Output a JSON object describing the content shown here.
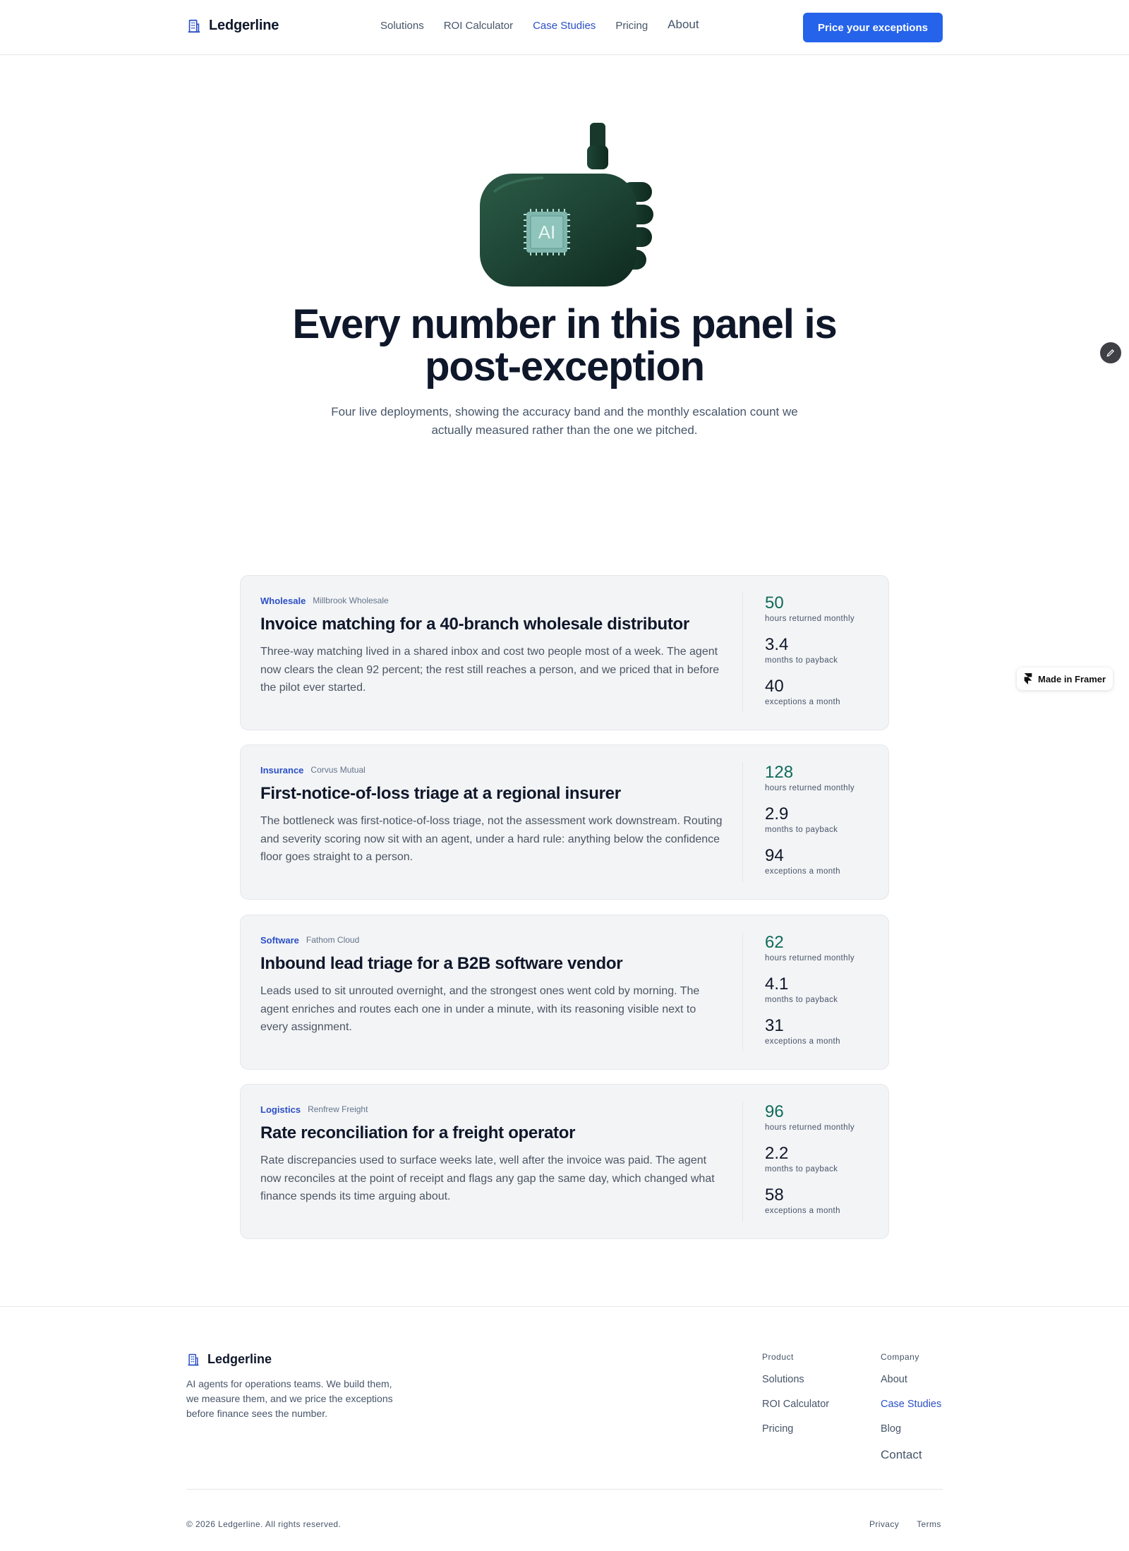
{
  "brand": {
    "name": "Ledgerline"
  },
  "nav": {
    "links": [
      "Solutions",
      "ROI Calculator",
      "Case Studies",
      "Pricing",
      "About"
    ],
    "active_link": "Case Studies",
    "cta_label": "Price your exceptions"
  },
  "hero": {
    "chip_label": "AI",
    "title": "Every number in this panel is post-exception",
    "subtitle": "Four live deployments, showing the accuracy band and the monthly escalation count we actually measured rather than the one we pitched."
  },
  "badges": {
    "framer": "Made in Framer"
  },
  "cases": [
    {
      "industry": "Wholesale",
      "client": "Millbrook Wholesale",
      "title": "Invoice matching for a 40-branch wholesale distributor",
      "body": "Three-way matching lived in a shared inbox and cost two people most of a week. The agent now clears the clean 92 percent; the rest still reaches a person, and we priced that in before the pilot ever started.",
      "stats": [
        {
          "value": "50",
          "label": "hours returned monthly"
        },
        {
          "value": "3.4",
          "label": "months to payback"
        },
        {
          "value": "40",
          "label": "exceptions a month"
        }
      ]
    },
    {
      "industry": "Insurance",
      "client": "Corvus Mutual",
      "title": "First-notice-of-loss triage at a regional insurer",
      "body": "The bottleneck was first-notice-of-loss triage, not the assessment work downstream. Routing and severity scoring now sit with an agent, under a hard rule: anything below the confidence floor goes straight to a person.",
      "stats": [
        {
          "value": "128",
          "label": "hours returned monthly"
        },
        {
          "value": "2.9",
          "label": "months to payback"
        },
        {
          "value": "94",
          "label": "exceptions a month"
        }
      ]
    },
    {
      "industry": "Software",
      "client": "Fathom Cloud",
      "title": "Inbound lead triage for a B2B software vendor",
      "body": "Leads used to sit unrouted overnight, and the strongest ones went cold by morning. The agent enriches and routes each one in under a minute, with its reasoning visible next to every assignment.",
      "stats": [
        {
          "value": "62",
          "label": "hours returned monthly"
        },
        {
          "value": "4.1",
          "label": "months to payback"
        },
        {
          "value": "31",
          "label": "exceptions a month"
        }
      ]
    },
    {
      "industry": "Logistics",
      "client": "Renfrew Freight",
      "title": "Rate reconciliation for a freight operator",
      "body": "Rate discrepancies used to surface weeks late, well after the invoice was paid. The agent now reconciles at the point of receipt and flags any gap the same day, which changed what finance spends its time arguing about.",
      "stats": [
        {
          "value": "96",
          "label": "hours returned monthly"
        },
        {
          "value": "2.2",
          "label": "months to payback"
        },
        {
          "value": "58",
          "label": "exceptions a month"
        }
      ]
    }
  ],
  "footer": {
    "brand_name": "Ledgerline",
    "description": "AI agents for operations teams. We build them, we measure them, and we price the exceptions before finance sees the number.",
    "columns": [
      {
        "heading": "Product",
        "links": [
          "Solutions",
          "ROI Calculator",
          "Pricing"
        ]
      },
      {
        "heading": "Company",
        "links": [
          "About",
          "Case Studies",
          "Blog",
          "Contact"
        ]
      }
    ],
    "copyright": "© 2026 Ledgerline. All rights reserved.",
    "legal": [
      "Privacy",
      "Terms"
    ]
  },
  "colors": {
    "accent": "#2563eb",
    "link_active": "#2b4fc7",
    "stat_accent": "#0f6b5a",
    "hero_art": "#1e4636"
  },
  "icons": [
    "building-icon",
    "edit-pencil-icon",
    "framer-logo-icon"
  ]
}
